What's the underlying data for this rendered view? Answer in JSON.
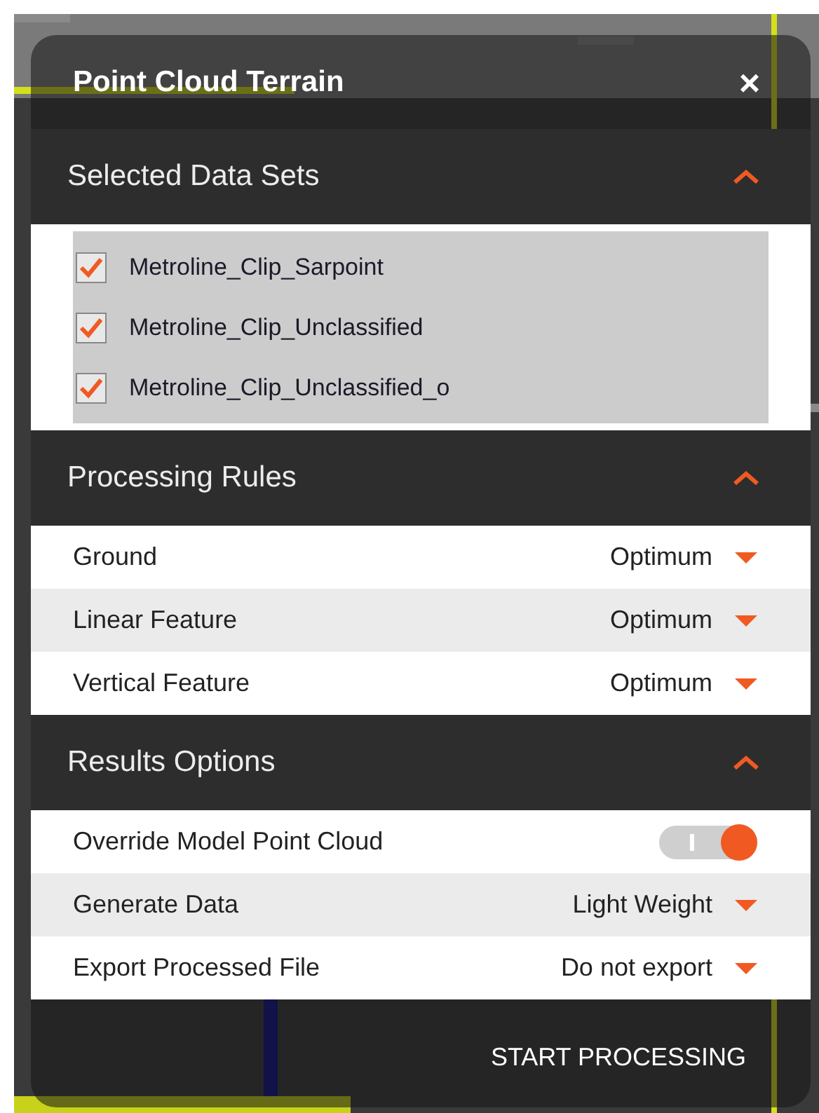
{
  "window": {
    "title": "Point Cloud Terrain",
    "close": "×"
  },
  "sections": [
    {
      "title": "Selected Data Sets",
      "expanded": true,
      "kind": "checklist",
      "items": [
        {
          "label": "Metroline_Clip_Sarpoint",
          "checked": true
        },
        {
          "label": "Metroline_Clip_Unclassified",
          "checked": true
        },
        {
          "label": "Metroline_Clip_Unclassified_o",
          "checked": true
        }
      ]
    },
    {
      "title": "Processing Rules",
      "expanded": true,
      "kind": "rows",
      "items": [
        {
          "kind": "dropdown",
          "label": "Ground",
          "value": "Optimum"
        },
        {
          "kind": "dropdown",
          "label": "Linear Feature",
          "value": "Optimum"
        },
        {
          "kind": "dropdown",
          "label": "Vertical Feature",
          "value": "Optimum"
        }
      ]
    },
    {
      "title": "Results Options",
      "expanded": true,
      "kind": "rows",
      "items": [
        {
          "kind": "toggle",
          "label": "Override Model Point Cloud",
          "on": true
        },
        {
          "kind": "dropdown",
          "label": "Generate Data",
          "value": "Light Weight"
        },
        {
          "kind": "dropdown",
          "label": "Export Processed File",
          "value": "Do not export"
        }
      ]
    }
  ],
  "action": "START PROCESSING"
}
